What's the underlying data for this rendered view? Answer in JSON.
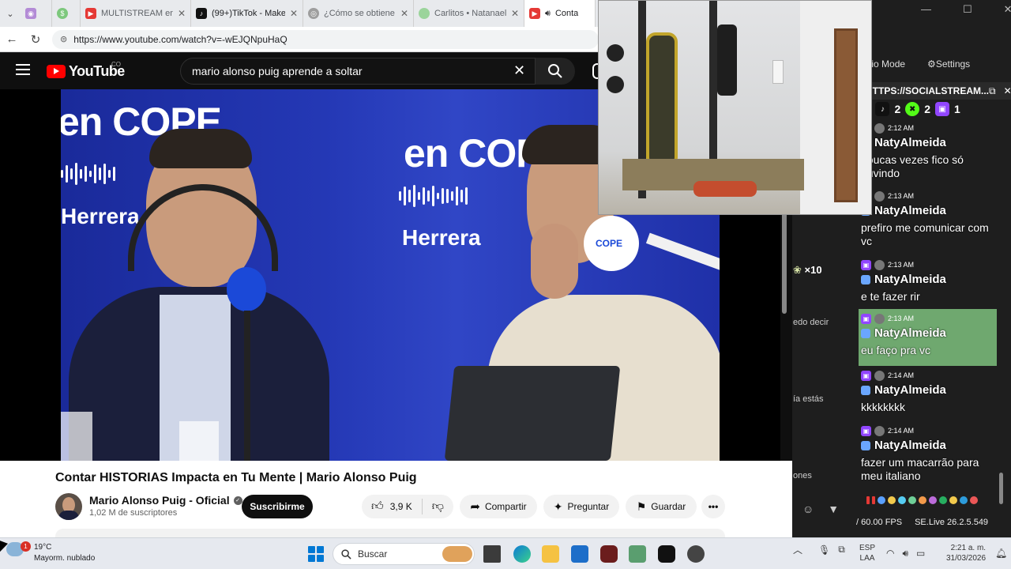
{
  "browser": {
    "tabs": [
      {
        "label": "",
        "icon": "app-icon",
        "color": "#b38bd6"
      },
      {
        "label": "",
        "icon": "app-icon",
        "color": "#7dc87d"
      },
      {
        "label": "MULTISTREAM en Ol",
        "icon": "youtube-icon",
        "color": "#e53935"
      },
      {
        "label": "(99+)TikTok - Make Y",
        "icon": "tiktok-icon",
        "color": "#111111"
      },
      {
        "label": "¿Cómo se obtiene u",
        "icon": "globe-icon",
        "color": "#888888"
      },
      {
        "label": "Carlitos • Natanael C",
        "icon": "spotify-icon",
        "color": "#9bd49b"
      },
      {
        "label": "Conta",
        "icon": "youtube-icon",
        "color": "#e53935"
      }
    ],
    "url": "https://www.youtube.com/watch?v=-wEJQNpuHaQ"
  },
  "youtube": {
    "logo_text": "YouTube",
    "country_code": "CO",
    "search_query": "mario alonso puig aprende a soltar",
    "video": {
      "brand_text": "en COPE",
      "show_text": "Herrera",
      "mic_text": "COPE"
    },
    "title": "Contar HISTORIAS Impacta en Tu Mente | Mario Alonso Puig",
    "channel_name": "Mario Alonso Puig - Oficial",
    "subscribers": "1,02 M de suscriptores",
    "subscribe_label": "Suscribirme",
    "likes": "3,9 K",
    "share_label": "Compartir",
    "ask_label": "Preguntar",
    "save_label": "Guardar",
    "more_label": "•••"
  },
  "stream": {
    "mode_label": "udio Mode",
    "settings_label": "Settings",
    "source_url": "HTTPS://SOCIALSTREAM...",
    "pct_label": "%",
    "counts": [
      {
        "icon": "tiktok-icon",
        "value": "2",
        "color": "#111111"
      },
      {
        "icon": "kick-icon",
        "value": "2",
        "color": "#53fc18"
      },
      {
        "icon": "twitch-icon",
        "value": "1",
        "color": "#9146ff"
      }
    ],
    "side_texts": [
      "×10",
      "edo decir",
      "ía estás",
      "ones"
    ],
    "chat": [
      {
        "time": "2:12 AM",
        "user": "NatyAlmeida",
        "text": "poucas vezes fico só ouvindo",
        "highlight": false
      },
      {
        "time": "2:13 AM",
        "user": "NatyAlmeida",
        "text": "prefiro me comunicar com vc",
        "highlight": false
      },
      {
        "time": "2:13 AM",
        "user": "NatyAlmeida",
        "text": "e te fazer rir",
        "highlight": false
      },
      {
        "time": "2:13 AM",
        "user": "NatyAlmeida",
        "text": "eu faço pra vc",
        "highlight": true
      },
      {
        "time": "2:14 AM",
        "user": "NatyAlmeida",
        "text": "kkkkkkkk",
        "highlight": false
      },
      {
        "time": "2:14 AM",
        "user": "NatyAlmeida",
        "text": "fazer um macarrão para meu italiano",
        "highlight": false
      }
    ],
    "fps_label": "/ 60.00 FPS",
    "version_label": "SE.Live 26.2.5.549"
  },
  "taskbar": {
    "temperature": "19°C",
    "weather": "Mayorm. nublado",
    "weather_badge": "1",
    "search_placeholder": "Buscar",
    "lang_top": "ESP",
    "lang_bottom": "LAA",
    "time": "2:21 a. m.",
    "date": "31/03/2026"
  },
  "colors": {
    "youtube_red": "#ff0000",
    "twitch_purple": "#9146ff",
    "highlight_green": "#6fa86f",
    "windows_blue": "#0078d4"
  }
}
